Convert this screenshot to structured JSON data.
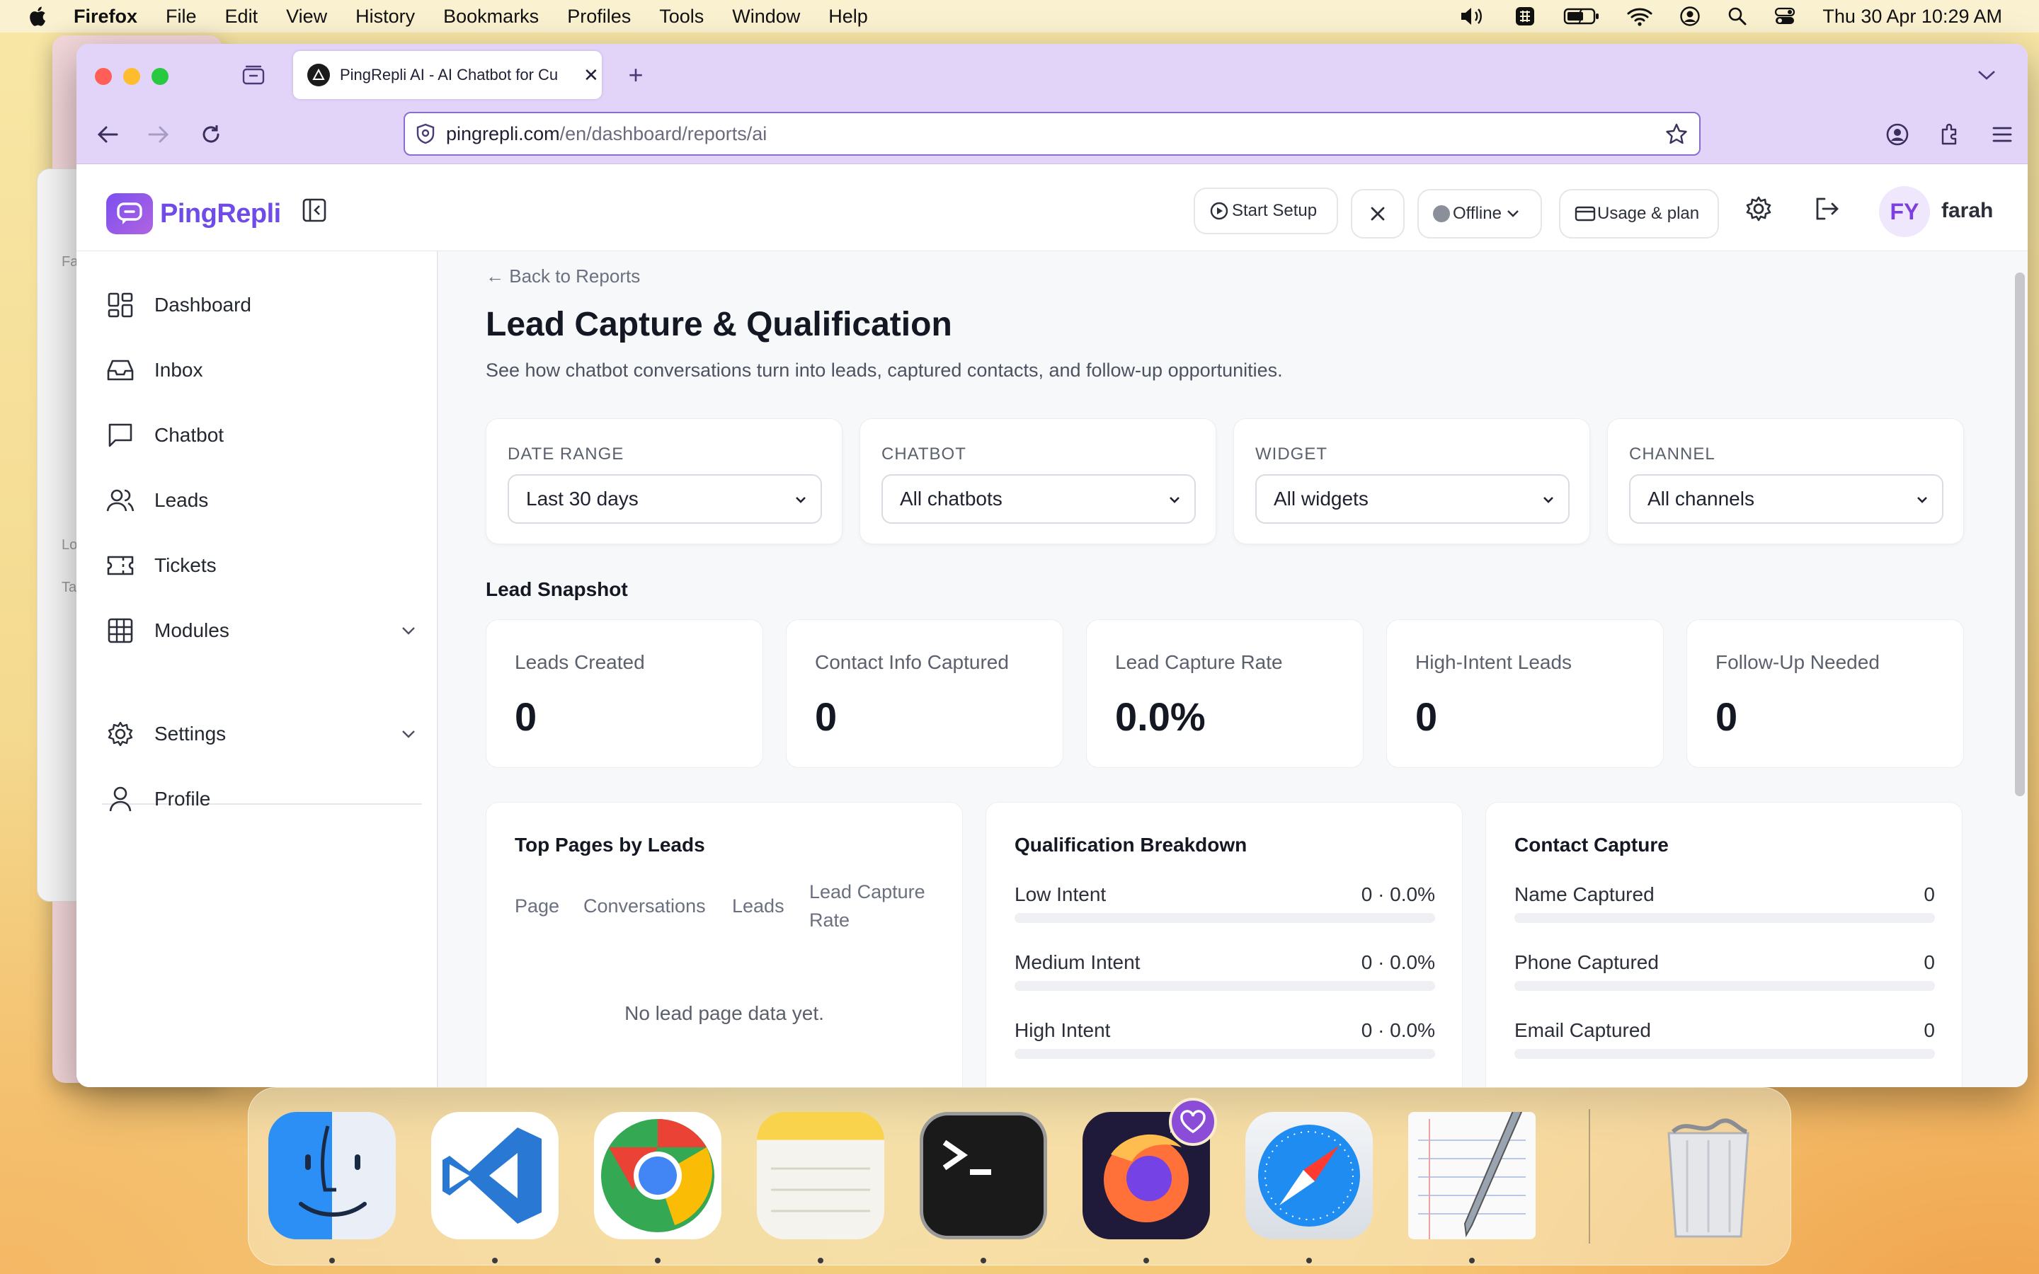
{
  "menubar": {
    "app": "Firefox",
    "items": [
      "File",
      "Edit",
      "View",
      "History",
      "Bookmarks",
      "Profiles",
      "Tools",
      "Window",
      "Help"
    ],
    "clock": "Thu 30 Apr  10:29 AM"
  },
  "browser": {
    "tab_title": "PingRepli AI - AI Chatbot for Cu",
    "url_host": "pingrepli.com",
    "url_path": "/en/dashboard/reports/ai"
  },
  "header": {
    "logo_text": "PingRepli",
    "start_setup": "Start Setup",
    "status": "Offline",
    "usage": "Usage & plan",
    "avatar_initials": "FY",
    "user": "farah",
    "status_color": "#8a8f99"
  },
  "sidebar": {
    "items": [
      {
        "label": "Dashboard",
        "icon": "dashboard-icon"
      },
      {
        "label": "Inbox",
        "icon": "inbox-icon"
      },
      {
        "label": "Chatbot",
        "icon": "chat-icon"
      },
      {
        "label": "Leads",
        "icon": "users-icon"
      },
      {
        "label": "Tickets",
        "icon": "ticket-icon"
      },
      {
        "label": "Modules",
        "icon": "grid-icon"
      },
      {
        "label": "Settings",
        "icon": "gear-icon"
      },
      {
        "label": "Profile",
        "icon": "user-icon"
      }
    ]
  },
  "main": {
    "back": "← Back to Reports",
    "title": "Lead Capture & Qualification",
    "subtitle": "See how chatbot conversations turn into leads, captured contacts, and follow-up opportunities.",
    "filters": [
      {
        "label": "DATE RANGE",
        "value": "Last 30 days"
      },
      {
        "label": "CHATBOT",
        "value": "All chatbots"
      },
      {
        "label": "WIDGET",
        "value": "All widgets"
      },
      {
        "label": "CHANNEL",
        "value": "All channels"
      }
    ],
    "snapshot_title": "Lead Snapshot",
    "stats": [
      {
        "label": "Leads Created",
        "value": "0"
      },
      {
        "label": "Contact Info Captured",
        "value": "0"
      },
      {
        "label": "Lead Capture Rate",
        "value": "0.0%"
      },
      {
        "label": "High-Intent Leads",
        "value": "0"
      },
      {
        "label": "Follow-Up Needed",
        "value": "0"
      }
    ],
    "top_pages": {
      "title": "Top Pages by Leads",
      "columns": [
        "Page",
        "Conversations",
        "Leads",
        "Lead Capture Rate"
      ],
      "empty": "No lead page data yet."
    },
    "qualification": {
      "title": "Qualification Breakdown",
      "rows": [
        {
          "label": "Low Intent",
          "value": "0 · 0.0%"
        },
        {
          "label": "Medium Intent",
          "value": "0 · 0.0%"
        },
        {
          "label": "High Intent",
          "value": "0 · 0.0%"
        }
      ]
    },
    "contact": {
      "title": "Contact Capture",
      "rows": [
        {
          "label": "Name Captured",
          "value": "0"
        },
        {
          "label": "Phone Captured",
          "value": "0"
        },
        {
          "label": "Email Captured",
          "value": "0"
        }
      ]
    }
  },
  "colors": {
    "accent": "#6f4ce8",
    "tabbar": "#e2d4f9"
  },
  "dock": {
    "apps": [
      "finder-icon",
      "vscode-icon",
      "chrome-icon",
      "notes-icon",
      "terminal-icon",
      "firefox-icon",
      "safari-icon",
      "textedit-icon",
      "trash-icon"
    ]
  }
}
